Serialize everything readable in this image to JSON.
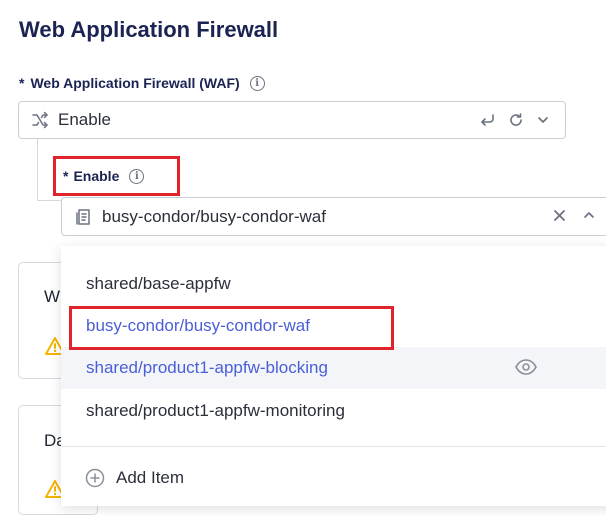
{
  "page": {
    "title": "Web Application Firewall"
  },
  "waf_field": {
    "required_mark": "*",
    "label": "Web Application Firewall (WAF)",
    "info_glyph": "i",
    "value": "Enable",
    "icons": [
      "shuffle-icon",
      "undo-icon",
      "refresh-icon",
      "chevron-down-icon"
    ]
  },
  "enable_field": {
    "required_mark": "*",
    "label": "Enable",
    "info_glyph": "i",
    "value": "busy-condor/busy-condor-waf",
    "icons": [
      "document-list-icon",
      "clear-icon",
      "chevron-up-icon"
    ]
  },
  "cards": [
    {
      "title_fragment": "W",
      "icon": "warning-icon"
    },
    {
      "title_fragment": "Da",
      "icon": "warning-icon"
    }
  ],
  "dropdown": {
    "options": [
      {
        "label": "shared/base-appfw",
        "state": "normal"
      },
      {
        "label": "busy-condor/busy-condor-waf",
        "state": "selected"
      },
      {
        "label": "shared/product1-appfw-blocking",
        "state": "hover"
      },
      {
        "label": "shared/product1-appfw-monitoring",
        "state": "normal"
      }
    ],
    "add_item_label": "Add Item"
  },
  "colors": {
    "title": "#1a2352",
    "accent": "#4a5fd6",
    "highlight_box": "#e0242a",
    "warning": "#f5b400",
    "border": "#c9cdd4"
  }
}
